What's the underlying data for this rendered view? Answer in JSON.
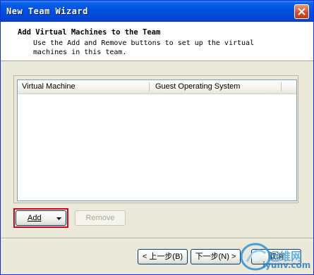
{
  "window": {
    "title": "New Team Wizard"
  },
  "header": {
    "title": "Add Virtual Machines to the Team",
    "description": "Use the Add and Remove buttons to set up the virtual machines in this team."
  },
  "list": {
    "columns": [
      "Virtual Machine",
      "Guest Operating System"
    ]
  },
  "buttons": {
    "add": "Add",
    "remove": "Remove",
    "back": "< 上一步(B)",
    "next": "下一步(N) >",
    "cancel": "取消"
  },
  "watermark": {
    "brand": "运维网",
    "site": "iyunv.com"
  },
  "colors": {
    "titlebar": "#0054e3",
    "highlight": "#d0021b",
    "dialog_bg": "#ece9d8"
  }
}
